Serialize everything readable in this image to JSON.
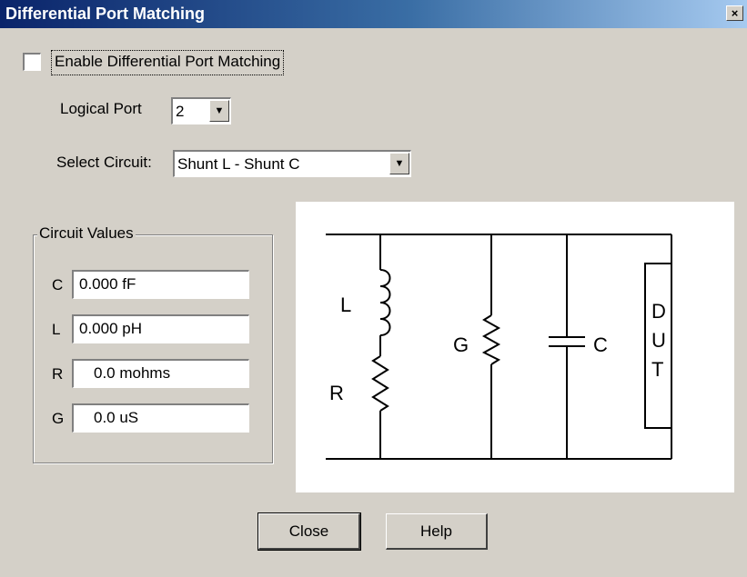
{
  "window": {
    "title": "Differential Port Matching",
    "close_glyph": "×"
  },
  "enable": {
    "label": "Enable Differential Port Matching",
    "checked": false
  },
  "logical_port": {
    "label": "Logical Port",
    "value": "2"
  },
  "select_circuit": {
    "label": "Select Circuit:",
    "value": "Shunt L - Shunt C"
  },
  "circuit_values": {
    "title": "Circuit Values",
    "fields": [
      {
        "label": "C",
        "value": "0.000 fF"
      },
      {
        "label": "L",
        "value": "0.000 pH"
      },
      {
        "label": "R",
        "value": "0.0 mohms"
      },
      {
        "label": "G",
        "value": "0.0 uS"
      }
    ]
  },
  "diagram": {
    "labels": {
      "L": "L",
      "R": "R",
      "G": "G",
      "C": "C",
      "dut": [
        "D",
        "U",
        "T"
      ]
    }
  },
  "buttons": {
    "close": "Close",
    "help": "Help"
  },
  "icons": {
    "combo_arrow": "▼",
    "window_close": "close-icon"
  }
}
